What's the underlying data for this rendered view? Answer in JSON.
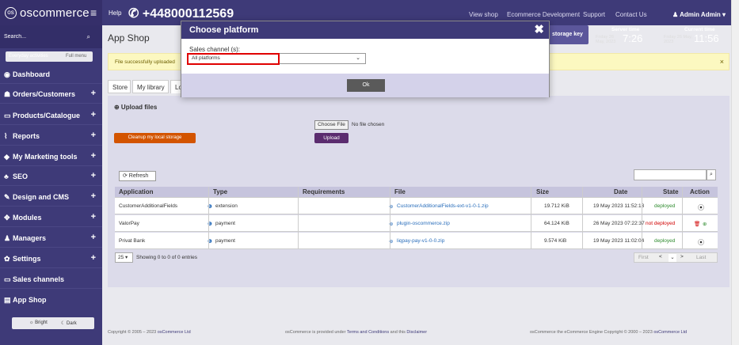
{
  "topbar": {
    "logo_text": "oscommerce",
    "help": "Help",
    "phone": "+448000112569",
    "links": [
      "View shop",
      "Ecommerce Development",
      "Support",
      "Contact Us"
    ],
    "admin": "Admin Admin",
    "server_time_label": "Server time",
    "server_date": "Friday 26 May, 2023",
    "server_time": "7:26",
    "current_time_label": "Current time",
    "current_date": "Friday 26 May, 2023",
    "current_time": "11:56",
    "storage_key": "storage key"
  },
  "sidebar": {
    "search_placeholder": "Search...",
    "toggle_left": "Everyday activities",
    "toggle_right": "Full menu",
    "items": [
      {
        "label": "Dashboard",
        "icon": "dashboard-icon",
        "glyph": "◉",
        "plus": ""
      },
      {
        "label": "Orders/Customers",
        "icon": "users-icon",
        "glyph": "☗",
        "plus": "+"
      },
      {
        "label": "Products/Catalogue",
        "icon": "folder-icon",
        "glyph": "▭",
        "plus": "+"
      },
      {
        "label": "Reports",
        "icon": "chart-icon",
        "glyph": "⌇",
        "plus": "+"
      },
      {
        "label": "My Marketing tools",
        "icon": "tag-icon",
        "glyph": "◆",
        "plus": "+"
      },
      {
        "label": "SEO",
        "icon": "sitemap-icon",
        "glyph": "♣",
        "plus": "+"
      },
      {
        "label": "Design and CMS",
        "icon": "brush-icon",
        "glyph": "✎",
        "plus": "+"
      },
      {
        "label": "Modules",
        "icon": "modules-icon",
        "glyph": "✥",
        "plus": "+"
      },
      {
        "label": "Managers",
        "icon": "user-icon",
        "glyph": "♟",
        "plus": "+"
      },
      {
        "label": "Settings",
        "icon": "cogs-icon",
        "glyph": "✿",
        "plus": "+"
      },
      {
        "label": "Sales channels",
        "icon": "monitor-icon",
        "glyph": "▭",
        "plus": ""
      },
      {
        "label": "App Shop",
        "icon": "store-icon",
        "glyph": "▤",
        "plus": ""
      }
    ],
    "theme_bright": "☼ Bright",
    "theme_dark": "☾ Dark"
  },
  "main": {
    "title": "App Shop",
    "alert": "File successfully uploaded",
    "alert_close": "×",
    "tabs": [
      "Store",
      "My library",
      "Lo"
    ],
    "upload_header": "⊕ Upload files",
    "cleanup_button": "Cleanup my local storage",
    "choose_file": "Choose File",
    "no_file": "No file chosen",
    "upload_button": "Upload",
    "refresh_button": "⟳ Refresh",
    "columns": [
      "Application",
      "Type",
      "Requirements",
      "File",
      "Size",
      "Date",
      "State",
      "Action"
    ],
    "rows": [
      {
        "app": "CustomerAdditionalFields",
        "type": "extension",
        "req": "",
        "file": "CustomerAdditionalFields-ext-v1-0-1.zip",
        "size": "19.712 KiB",
        "date": "19 May 2023 11:52:13",
        "state": "deployed",
        "state_color": "#2e8b2e"
      },
      {
        "app": "ValorPay",
        "type": "payment",
        "req": "",
        "file": "plugin-oscommerce.zip",
        "size": "64.124 KiB",
        "date": "26 May 2023 07:22:37",
        "state": "not deployed",
        "state_color": "#d00000"
      },
      {
        "app": "Privat Bank",
        "type": "payment",
        "req": "",
        "file": "liqpay-pay-v1-0-0.zip",
        "size": "9.574 KiB",
        "date": "19 May 2023 11:02:04",
        "state": "deployed",
        "state_color": "#2e8b2e"
      }
    ],
    "page_size": "25",
    "showing": "Showing 0 to 0 of 0 entries",
    "pager": [
      "First",
      "<",
      "⌄",
      ">",
      "Last"
    ]
  },
  "footer": {
    "copyright": "Copyright © 2005 – 2023",
    "copyright_link": "osCommerce Ltd",
    "middle_prefix": "osCommerce is provided under",
    "middle_link1": "Terms and Conditions",
    "middle_and": "and this",
    "middle_link2": "Disclaimer",
    "right_prefix": "osCommerce the eCommerce Engine Copyright © 2000 – 2023",
    "right_link": "osCommerce Ltd"
  },
  "modal": {
    "title": "Choose platform",
    "close": "✖",
    "label": "Sales channel (s):",
    "selected": "All platforms",
    "ok": "Ok"
  },
  "colors": {
    "brand": "#3e3a78",
    "accent": "#d35400",
    "upload": "#5b2c6f"
  }
}
